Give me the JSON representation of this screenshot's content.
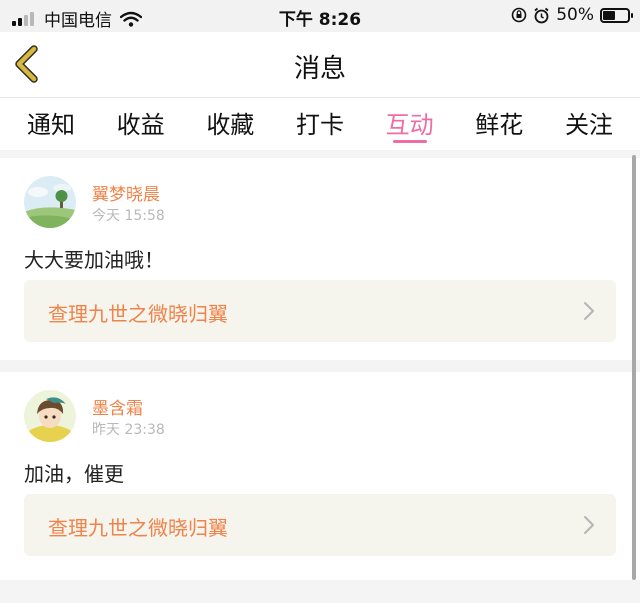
{
  "status_bar": {
    "carrier": "中国电信",
    "time": "下午 8:26",
    "battery": "50%",
    "icons": [
      "signal-icon",
      "wifi-icon",
      "rotation-lock-icon",
      "alarm-icon",
      "battery-icon"
    ]
  },
  "header": {
    "title": "消息",
    "back_icon": "chevron-left-icon"
  },
  "tabs": [
    {
      "label": "通知",
      "active": false
    },
    {
      "label": "收益",
      "active": false
    },
    {
      "label": "收藏",
      "active": false
    },
    {
      "label": "打卡",
      "active": false
    },
    {
      "label": "互动",
      "active": true
    },
    {
      "label": "鲜花",
      "active": false
    },
    {
      "label": "关注",
      "active": false
    }
  ],
  "messages": [
    {
      "username": "翼梦晓晨",
      "time": "今天 15:58",
      "text": "大大要加油哦！",
      "ref_title": "查理九世之微晓归翼"
    },
    {
      "username": "墨含霜",
      "time": "昨天 23:38",
      "text": "加油，催更",
      "ref_title": "查理九世之微晓归翼"
    }
  ],
  "colors": {
    "accent_pink": "#ee6da4",
    "username_orange": "#f0834a",
    "back_arrow": "#d7b83a",
    "ref_bg": "#f5f5ee"
  }
}
